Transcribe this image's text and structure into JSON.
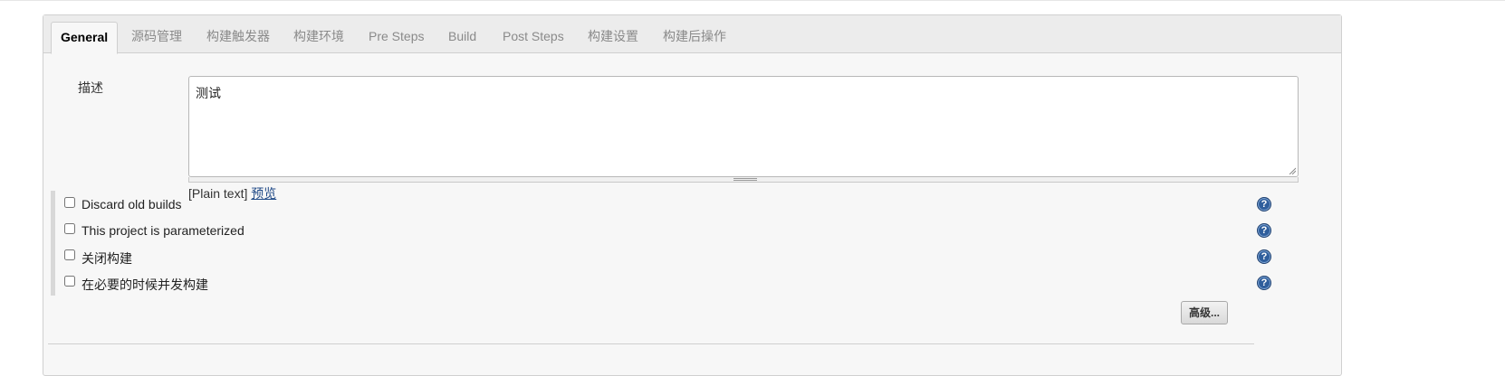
{
  "tabs": [
    {
      "label": "General",
      "active": true
    },
    {
      "label": "源码管理"
    },
    {
      "label": "构建触发器"
    },
    {
      "label": "构建环境"
    },
    {
      "label": "Pre Steps"
    },
    {
      "label": "Build"
    },
    {
      "label": "Post Steps"
    },
    {
      "label": "构建设置"
    },
    {
      "label": "构建后操作"
    }
  ],
  "description": {
    "label": "描述",
    "value": "测试",
    "format_text": "[Plain text]",
    "preview_link": "预览"
  },
  "options": [
    {
      "label": "Discard old builds",
      "checked": false
    },
    {
      "label": "This project is parameterized",
      "checked": false
    },
    {
      "label": "关闭构建",
      "checked": false
    },
    {
      "label": "在必要的时候并发构建",
      "checked": false
    }
  ],
  "help_icon_glyph": "?",
  "advanced_button": "高级..."
}
